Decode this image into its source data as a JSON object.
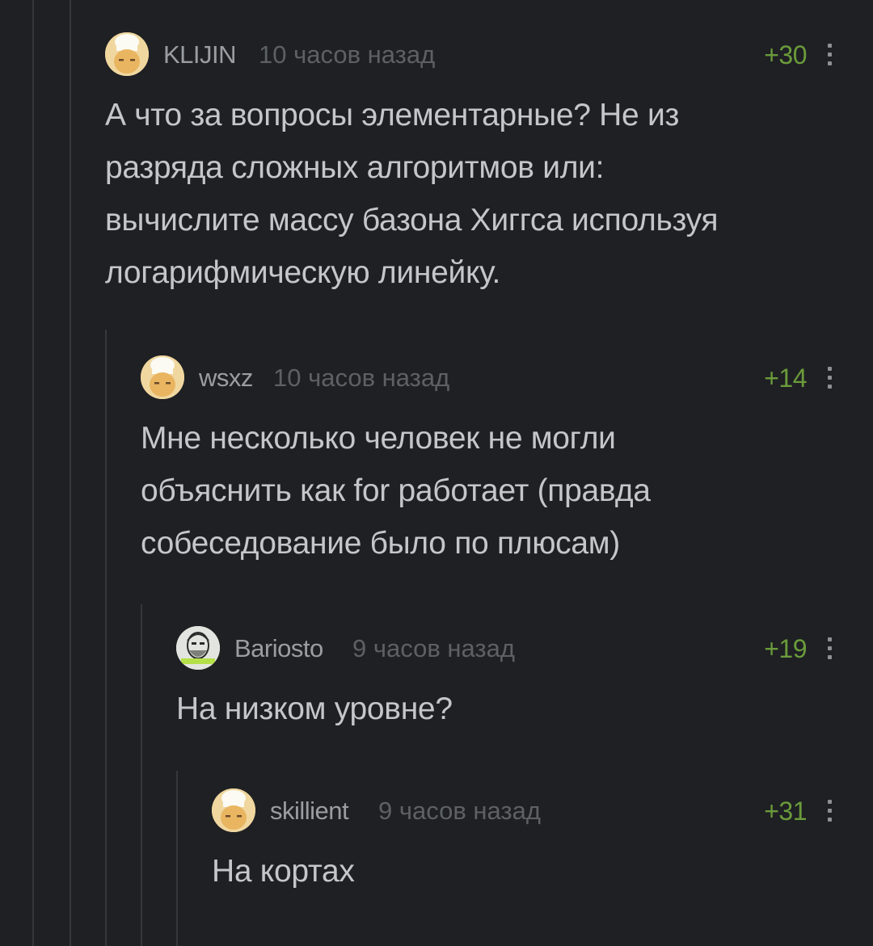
{
  "comments": [
    {
      "username": "KLIJIN",
      "time": "10 часов назад",
      "rating": "+30",
      "avatar": "chef-avatar-icon",
      "lines": [
        "А что за вопросы элементарные? Не из",
        "разряда сложных алгоритмов или:",
        "вычислите массу базона Хиггса используя",
        "логарифмическую линейку."
      ]
    },
    {
      "username": "wsxz",
      "time": "10 часов назад",
      "rating": "+14",
      "avatar": "chef-avatar-icon",
      "lines": [
        "Мне несколько человек не могли",
        "объяснить как for работает (правда",
        "собеседование было по плюсам)"
      ]
    },
    {
      "username": "Bariosto",
      "time": "9 часов назад",
      "rating": "+19",
      "avatar": "bearded-man-avatar-icon",
      "lines": [
        "На низком уровне?"
      ]
    },
    {
      "username": "skillient",
      "time": "9 часов назад",
      "rating": "+31",
      "avatar": "chef-avatar-icon",
      "lines": [
        "На кортах"
      ]
    }
  ],
  "colors": {
    "background": "#1e2023",
    "rating_positive": "#6b9b3b",
    "username": "#9a9da2",
    "timestamp": "#5d6065",
    "text": "#c4c6ca"
  }
}
